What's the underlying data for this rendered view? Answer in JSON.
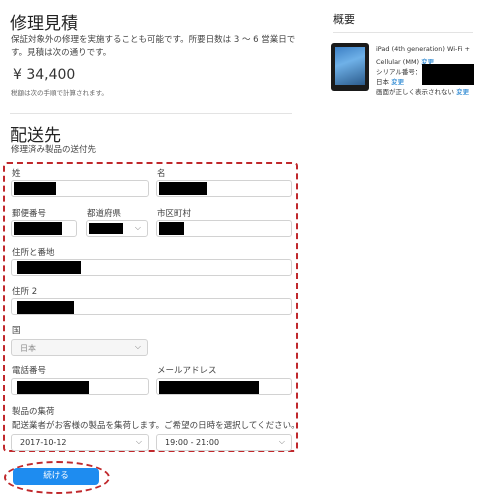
{
  "quote": {
    "title": "修理見積",
    "description_line1": "保証対象外の修理を実施することも可能です。所要日数は 3 ～ 6 営業日で",
    "description_line2": "す。見積は次の通りです。",
    "price": "¥ 34,400",
    "tax_note": "税額は次の手順で計算されます。"
  },
  "shipping": {
    "title": "配送先",
    "subtitle": "修理済み製品の送付先",
    "fields": {
      "last_name_label": "姓",
      "first_name_label": "名",
      "postal_label": "郵便番号",
      "prefecture_label": "都道府県",
      "city_label": "市区町村",
      "address1_label": "住所と番地",
      "address2_label": "住所 2",
      "country_label": "国",
      "country_value": "日本",
      "phone_label": "電話番号",
      "email_label": "メールアドレス"
    },
    "pickup": {
      "title": "製品の集荷",
      "description": "配送業者がお客様の製品を集荷します。ご希望の日時を選択してください。",
      "date_value": "2017-10-12",
      "time_value": "19:00 - 21:00"
    },
    "continue_label": "続ける"
  },
  "summary": {
    "title": "概要",
    "product_line1": "iPad (4th generation) Wi-Fi +",
    "product_line2": "Cellular (MM)",
    "change_label": "変更",
    "serial_label": "シリアル番号：",
    "country_label": "日本",
    "screen_issue": "画面が正しく表示されない"
  },
  "icons": {
    "chevron": "chevron-down-icon",
    "product": "ipad-image"
  },
  "colors": {
    "link": "#0070c9",
    "button": "#1e8cf0",
    "annotation": "#c0282c"
  }
}
